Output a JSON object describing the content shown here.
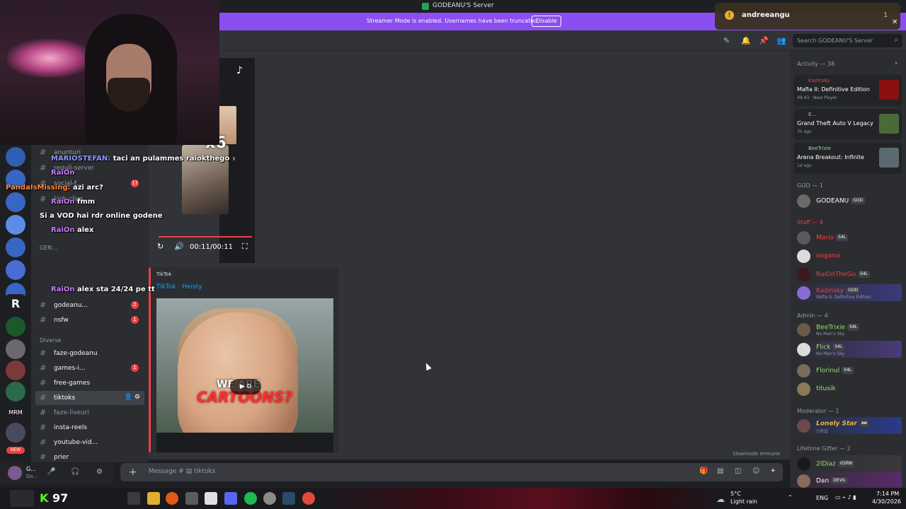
{
  "titlebar": {
    "title": "GODEANU'S Server"
  },
  "banner": {
    "message": "Streamer Mode is enabled. Usernames have been truncated.",
    "button": "Disable"
  },
  "header": {
    "search_placeholder": "Search GODEANU'S Server"
  },
  "toast": {
    "name": "andreeangu",
    "count": "1"
  },
  "twitch_chat": [
    {
      "user": "MARIOSTEFAN:",
      "text": "taci an pulammes raiokthego"
    },
    {
      "user": "RaiOn",
      "text": ""
    },
    {
      "user": "PandaIsMissing:",
      "text": "azi arc?"
    },
    {
      "user": "RaiOn",
      "text": "fmm"
    },
    {
      "user": "",
      "text": "Si a VOD hai rdr online godene"
    },
    {
      "user": "RaiOn",
      "text": "alex"
    },
    {
      "user": "RaiOn",
      "text": "alex sta 24/24 pe tt"
    }
  ],
  "channels": {
    "categories": {
      "general": "GEN...",
      "diverse": "Diverse"
    },
    "items": [
      {
        "label": "anunturi",
        "badge": ""
      },
      {
        "label": "reguli-server",
        "badge": ""
      },
      {
        "label": "social-f...",
        "badge": "17"
      },
      {
        "label": "kick-clips",
        "badge": ""
      },
      {
        "label": "godeanu...",
        "badge": "2"
      },
      {
        "label": "nsfw",
        "badge": "1"
      },
      {
        "label": "faze-godeanu",
        "badge": ""
      },
      {
        "label": "games-i...",
        "badge": "1"
      },
      {
        "label": "free-games",
        "badge": ""
      },
      {
        "label": "tiktoks",
        "badge": ""
      },
      {
        "label": "faze-liveuri",
        "badge": ""
      },
      {
        "label": "insta-reels",
        "badge": ""
      },
      {
        "label": "youtube-vid...",
        "badge": ""
      },
      {
        "label": "prier",
        "badge": ""
      }
    ]
  },
  "tiktok": {
    "counter": "x6",
    "timer": "00:11/00:11",
    "embed_provider": "TikTok",
    "embed_title": "TikTok · Heisty",
    "caption_top": "WE ARE",
    "caption_bottom": "CARTOONS?"
  },
  "composer": {
    "placeholder": "Message # ▤ tiktoks",
    "slowmode": "Slowmode Immune"
  },
  "userpanel": {
    "name": "G...",
    "status": "Do..."
  },
  "members": {
    "activity_title": "Activity — 38",
    "activities": [
      {
        "user": "Kazinsky",
        "game": "Mafia II: Definitive Edition",
        "time": "49:43",
        "extra": "New Player",
        "color": "#f23f43"
      },
      {
        "user": "E...",
        "game": "Grand Theft Auto V Legacy",
        "time": "7h ago",
        "extra": "",
        "color": "#b5bac1"
      },
      {
        "user": "BeeTrixie",
        "game": "Arena Breakout: Infinite",
        "time": "1d ago",
        "extra": "",
        "color": "#8fd694"
      }
    ],
    "god_title": "GOD — 1",
    "god": [
      {
        "name": "GODEANU",
        "tag": "GOD",
        "color": "#ffffff"
      }
    ],
    "staff_title": "Staff — 4",
    "staff": [
      {
        "name": "Mario",
        "tag": "S4L",
        "status": "",
        "color": "#f23f43"
      },
      {
        "name": "oagana",
        "tag": "",
        "status": "",
        "color": "#f23f43"
      },
      {
        "name": "RaiOnTheGo",
        "tag": "S4L",
        "status": "",
        "color": "#f23f43"
      },
      {
        "name": "Kazinsky",
        "tag": "GOD",
        "status": "Mafia II: Definitive Edition",
        "color": "#f23f43"
      }
    ],
    "admin_title": "Admin — 4",
    "admin": [
      {
        "name": "BeeTrixie",
        "tag": "S4L",
        "status": "No Man's Sky",
        "color": "#9be26b"
      },
      {
        "name": "Flick",
        "tag": "S4L",
        "status": "No Man's Sky",
        "color": "#9be26b"
      },
      {
        "name": "Florinul",
        "tag": "S4L",
        "status": "",
        "color": "#9be26b"
      },
      {
        "name": "titusik",
        "tag": "",
        "status": "",
        "color": "#9be26b"
      }
    ],
    "mod_title": "Moderator — 1",
    "mods": [
      {
        "name": "Lonely Star",
        "tag": "xo",
        "status": "스타일",
        "color": "#f0b232"
      }
    ],
    "gifter_title": "Lifetime Gifter — 2",
    "gifters": [
      {
        "name": "2lDiaz",
        "tag": "GSRN",
        "status": "",
        "color": "#9be26b"
      },
      {
        "name": "Dan",
        "tag": "DEVIL",
        "status": "",
        "color": "#ffffff"
      }
    ]
  },
  "taskbar": {
    "kick_count": "97",
    "weather_temp": "5°C",
    "weather_desc": "Light rain",
    "lang": "ENG",
    "time": "7:14 PM",
    "date": "4/30/2026"
  },
  "rail": {
    "label_mrm": "MRM",
    "label_new": "NEW"
  }
}
